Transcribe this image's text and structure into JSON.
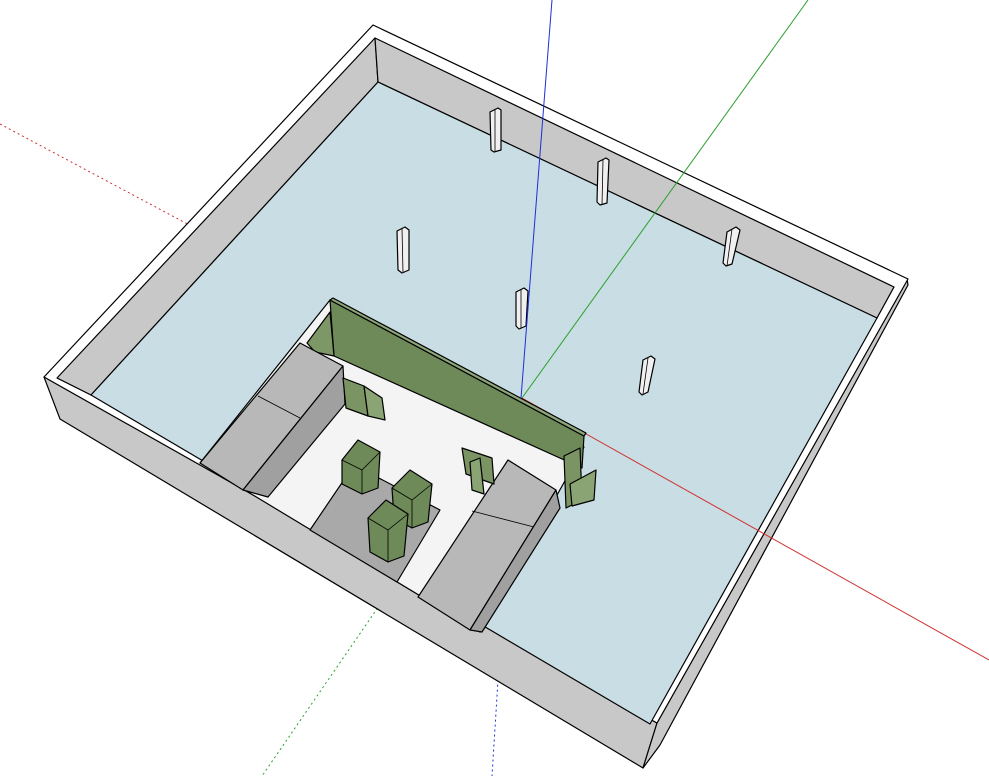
{
  "viewport": {
    "view_type": "3D model viewport",
    "axis_colors": {
      "red_axis": "#d03030",
      "green_axis": "#2ca02c",
      "blue_axis": "#1f2fd6"
    },
    "materials": {
      "wall_face": "#c8c8c8",
      "wall_top": "#ffffff",
      "floor": "#c9dde4",
      "partition": "#6e8a58",
      "booth_interior": "#f4f4f4",
      "gray_slab": "#a9a9a9"
    },
    "objects": {
      "columns_count": 6,
      "green_panels_count": 5
    }
  }
}
